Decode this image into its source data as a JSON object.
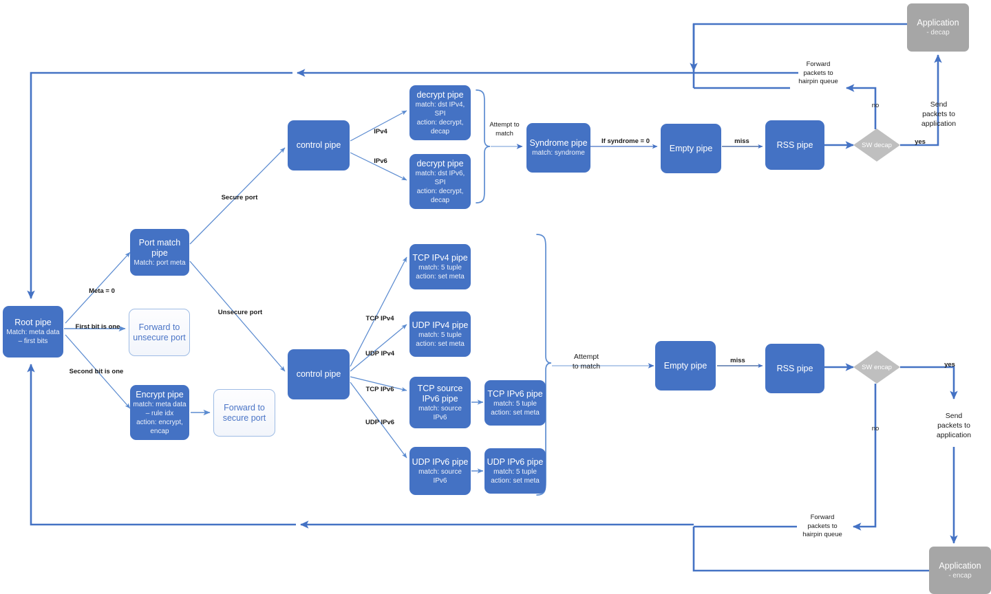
{
  "diagram": {
    "title": "DOCA packet processing pipeline",
    "colors": {
      "pipe_blue": "#4472c4",
      "application_gray": "#a6a6a6",
      "decision_gray": "#bfbfbf",
      "arrow_blue": "#4472c4",
      "thin_arrow_blue": "#5b8bd0",
      "light_fill": "#f2f5fb"
    }
  },
  "nodes": {
    "root_pipe": {
      "title": "Root pipe",
      "line2": "Match: meta data",
      "line3": "– first bits"
    },
    "port_match_pipe": {
      "title": "Port match",
      "title2": "pipe",
      "line3": "Match: port meta"
    },
    "forward_unsecure": {
      "line1": "Forward to",
      "line2": "unsecure port"
    },
    "encrypt_pipe": {
      "title": "Encrypt pipe",
      "line2": "match: meta data",
      "line3": "– rule idx",
      "line4": "action: encrypt,",
      "line5": "encap"
    },
    "forward_secure": {
      "line1": "Forward to",
      "line2": "secure port"
    },
    "control_pipe_top": {
      "title": "control pipe"
    },
    "control_pipe_mid": {
      "title": "control pipe"
    },
    "decrypt_pipe_v4": {
      "title": "decrypt pipe",
      "line2": "match: dst IPv4,",
      "line3": "SPI",
      "line4": "action: decrypt,",
      "line5": "decap"
    },
    "decrypt_pipe_v6": {
      "title": "decrypt pipe",
      "line2": "match: dst IPv6,",
      "line3": "SPI",
      "line4": "action: decrypt,",
      "line5": "decap"
    },
    "syndrome_pipe": {
      "title": "Syndrome pipe",
      "line2": "match: syndrome"
    },
    "empty_pipe_top": {
      "title": "Empty  pipe"
    },
    "rss_pipe_top": {
      "title": "RSS pipe"
    },
    "sw_decap": {
      "title": "SW decap"
    },
    "application_decap": {
      "title": "Application",
      "line2": "- decap"
    },
    "tcp_ipv4_pipe": {
      "title": "TCP IPv4 pipe",
      "line2": "match: 5 tuple",
      "line3": "action: set meta"
    },
    "udp_ipv4_pipe": {
      "title": "UDP IPv4 pipe",
      "line2": "match: 5 tuple",
      "line3": "action: set meta"
    },
    "tcp_src_ipv6_pipe": {
      "title": "TCP source",
      "title2": "IPv6 pipe",
      "line3": "match: source",
      "line4": "IPv6"
    },
    "tcp_ipv6_pipe": {
      "title": "TCP IPv6 pipe",
      "line2": "match: 5 tuple",
      "line3": "action: set meta"
    },
    "udp_src_ipv6_pipe": {
      "title": "UDP IPv6  pipe",
      "line2": "match: source",
      "line3": "IPv6"
    },
    "udp_ipv6_pipe": {
      "title": "UDP IPv6  pipe",
      "line2": "match: 5 tuple",
      "line3": "action: set meta"
    },
    "empty_pipe_bot": {
      "title": "Empty  pipe"
    },
    "rss_pipe_bot": {
      "title": "RSS pipe"
    },
    "sw_encap": {
      "title": "SW encap"
    },
    "application_encap": {
      "title": "Application",
      "line2": "- encap"
    }
  },
  "edge_labels": {
    "meta_zero": "Meta = 0",
    "first_bit_one": "First bit is one",
    "second_bit_one": "Second bit is one",
    "secure_port": "Secure port",
    "unsecure_port": "Unsecure port",
    "ipv4": "IPv4",
    "ipv6": "IPv6",
    "attempt_to_match_top": "Attempt to\nmatch",
    "if_syndrome_zero": "If syndrome = 0",
    "miss_top": "miss",
    "no_top": "no",
    "yes_top": "yes",
    "forward_hairpin_top": "Forward\npackets to\nhairpin queue",
    "send_to_app_top": "Send\npackets to\napplication",
    "tcp_ipv4": "TCP IPv4",
    "udp_ipv4": "UDP IPv4",
    "tcp_ipv6": "TCP IPv6",
    "udp_ipv6": "UDP IPv6",
    "attempt_to_match_bot": "Attempt\nto match",
    "miss_bot": "miss",
    "no_bot": "no",
    "yes_bot": "yes",
    "forward_hairpin_bot": "Forward\npackets to\nhairpin queue",
    "send_to_app_bot": "Send\npackets to\napplication"
  }
}
